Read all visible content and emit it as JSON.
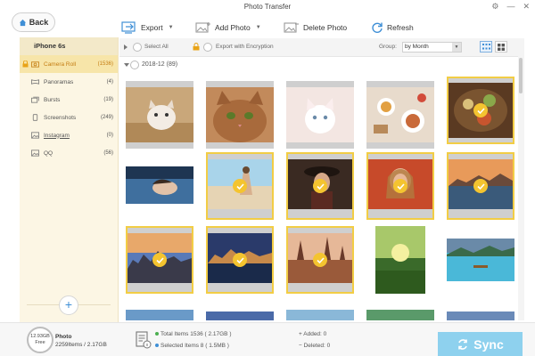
{
  "window": {
    "title": "Photo Transfer"
  },
  "back": {
    "label": "Back"
  },
  "toolbar": {
    "export_label": "Export",
    "add_label": "Add Photo",
    "delete_label": "Delete Photo",
    "refresh_label": "Refresh"
  },
  "sidebar": {
    "device": "iPhone 6s",
    "items": [
      {
        "label": "Camera Roll",
        "count": "(1536)",
        "icon": "camera-icon"
      },
      {
        "label": "Panoramas",
        "count": "(4)",
        "icon": "panorama-icon"
      },
      {
        "label": "Bursts",
        "count": "(19)",
        "icon": "burst-icon"
      },
      {
        "label": "Screenshots",
        "count": "(249)",
        "icon": "phone-icon"
      },
      {
        "label": "Instagram",
        "count": "(0)",
        "icon": "photo-album-icon"
      },
      {
        "label": "QQ",
        "count": "(56)",
        "icon": "photo-album-icon"
      }
    ]
  },
  "subbar": {
    "select_all": "Select All",
    "export_encryption": "Export with Encryption",
    "group_label": "Group:",
    "group_value": "by Month"
  },
  "group": {
    "title": "2018-12",
    "count": "(89)"
  },
  "photos": [
    {
      "subject": "kitten on rug",
      "selected": false
    },
    {
      "subject": "tabby cat face",
      "selected": false
    },
    {
      "subject": "white kitten",
      "selected": false
    },
    {
      "subject": "breakfast table",
      "selected": false
    },
    {
      "subject": "food platter",
      "selected": true
    },
    {
      "subject": "woman in water",
      "selected": false
    },
    {
      "subject": "woman on beach",
      "selected": true
    },
    {
      "subject": "woman with hat",
      "selected": true
    },
    {
      "subject": "woman portrait",
      "selected": true
    },
    {
      "subject": "coastal town sunset",
      "selected": true
    },
    {
      "subject": "city skyline sunset",
      "selected": true
    },
    {
      "subject": "city river night",
      "selected": true
    },
    {
      "subject": "old town cityscape",
      "selected": true
    },
    {
      "subject": "sunlit green field",
      "selected": false
    },
    {
      "subject": "tropical lagoon boat",
      "selected": false
    }
  ],
  "footer": {
    "storage_free": "12.93GB",
    "storage_label": "Free",
    "category": "Photo",
    "category_detail": "2259Items / 2.17GB",
    "total_items": "Total Items 1536 ( 2.17GB )",
    "selected_items": "Selected Items 8 ( 1.5MB )",
    "added": "Added: 0",
    "deleted": "Deleted: 0",
    "sync_label": "Sync"
  },
  "colors": {
    "accent_blue": "#3f8fd6",
    "selection_yellow": "#f4c430",
    "sidebar_bg": "#fcf6e4",
    "sync_bg": "#8ed1ee"
  }
}
